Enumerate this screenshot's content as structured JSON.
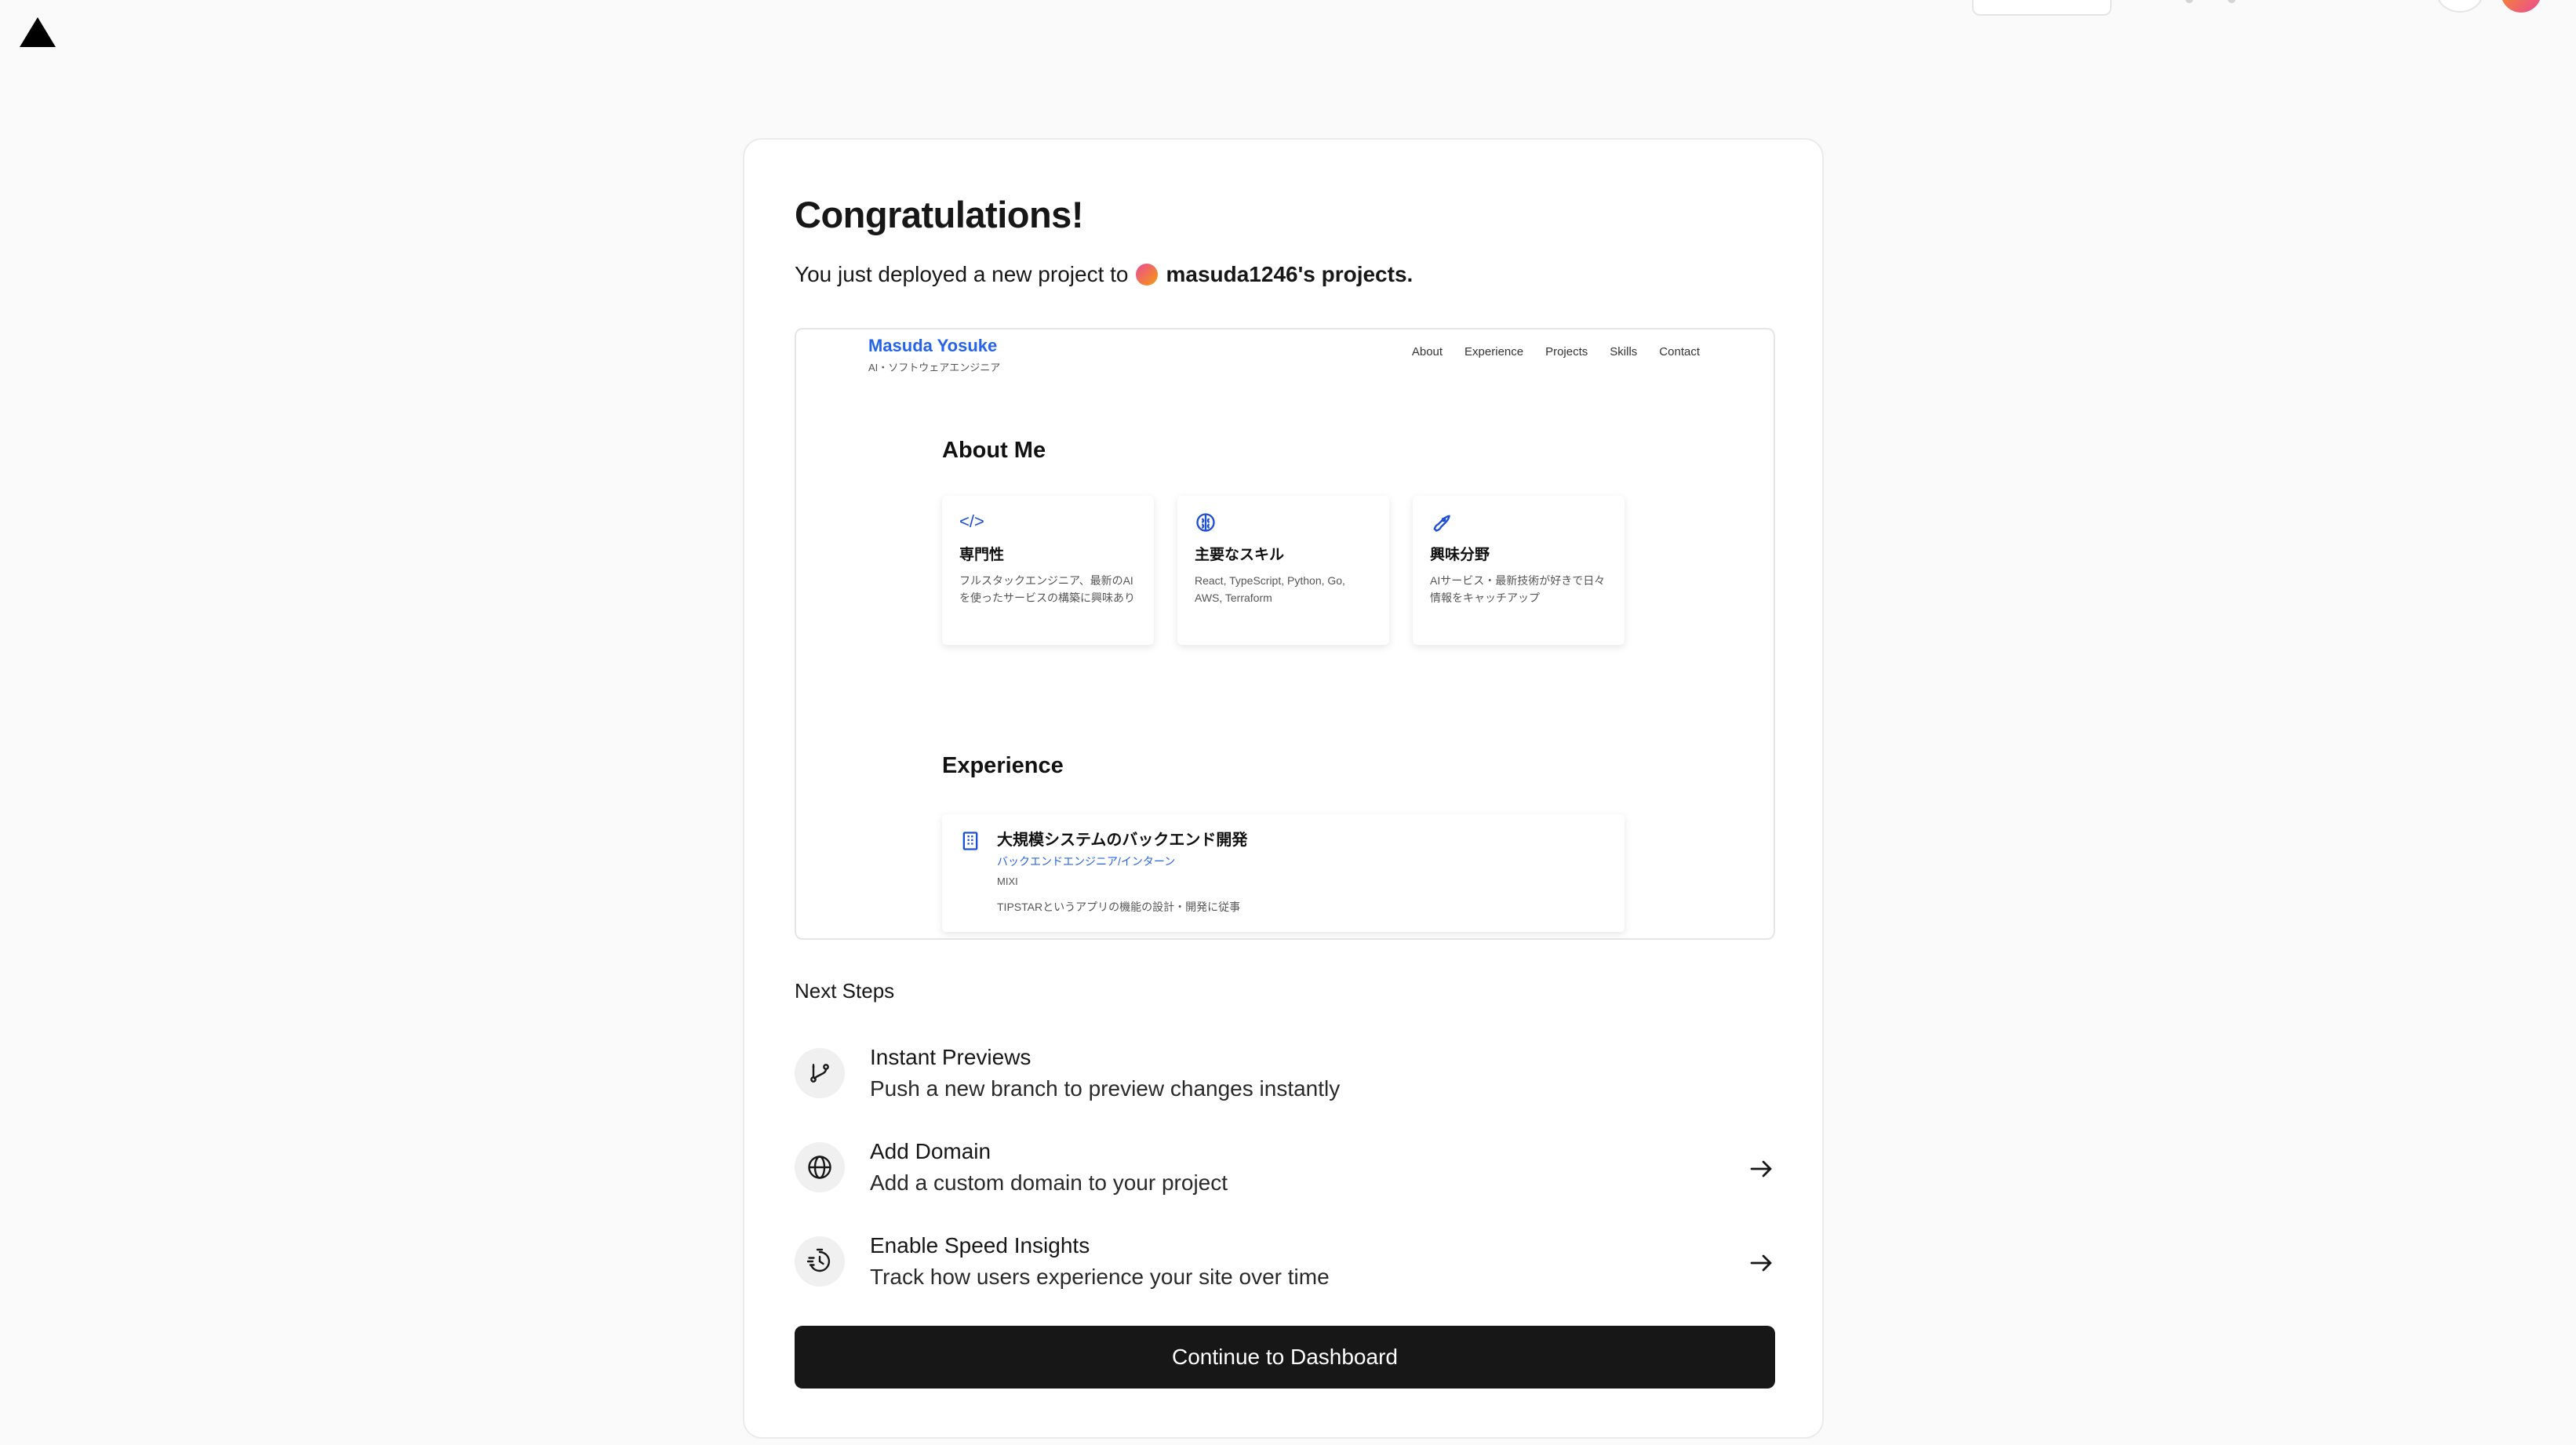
{
  "header": {
    "logo": "vercel-triangle-logo"
  },
  "main": {
    "title": "Congratulations!",
    "subtitle_prefix": "You just deployed a new project to",
    "project_owner": "masuda1246's projects."
  },
  "preview": {
    "site_name": "Masuda Yosuke",
    "site_role": "AI・ソフトウェアエンジニア",
    "nav": [
      "About",
      "Experience",
      "Projects",
      "Skills",
      "Contact"
    ],
    "about_heading": "About Me",
    "cards": [
      {
        "icon": "code-icon",
        "title": "専門性",
        "desc": "フルスタックエンジニア、最新のAIを使ったサービスの構築に興味あり"
      },
      {
        "icon": "brain-icon",
        "title": "主要なスキル",
        "desc": "React, TypeScript, Python, Go, AWS, Terraform"
      },
      {
        "icon": "rocket-icon",
        "title": "興味分野",
        "desc": "AIサービス・最新技術が好きで日々情報をキャッチアップ"
      }
    ],
    "experience_heading": "Experience",
    "experience": {
      "icon": "building-icon",
      "title": "大規模システムのバックエンド開発",
      "role": "バックエンドエンジニア/インターン",
      "company": "MIXI",
      "desc": "TIPSTARというアプリの機能の設計・開発に従事"
    }
  },
  "next_steps": {
    "label": "Next Steps",
    "items": [
      {
        "icon": "git-branch-icon",
        "title": "Instant Previews",
        "desc": "Push a new branch to preview changes instantly"
      },
      {
        "icon": "globe-icon",
        "title": "Add Domain",
        "desc": "Add a custom domain to your project"
      },
      {
        "icon": "speed-insights-icon",
        "title": "Enable Speed Insights",
        "desc": "Track how users experience your site over time"
      }
    ]
  },
  "cta": {
    "label": "Continue to Dashboard"
  }
}
